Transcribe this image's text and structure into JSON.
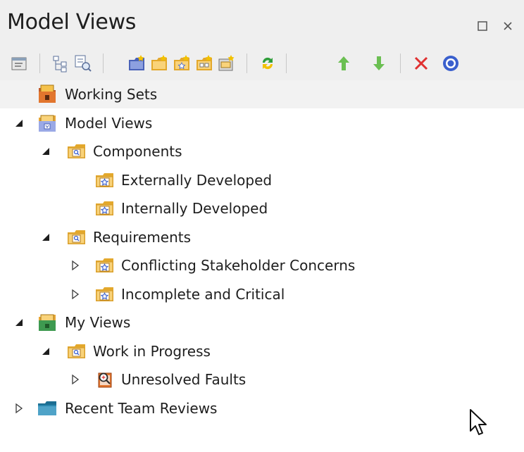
{
  "window": {
    "title": "Model Views",
    "controls": [
      "restore-icon",
      "close-icon"
    ]
  },
  "toolbar": {
    "buttons": [
      {
        "name": "properties-icon"
      },
      {
        "name": "tree-view-icon"
      },
      {
        "name": "find-element-icon"
      },
      {
        "name": "new-view-icon"
      },
      {
        "name": "new-folder-icon"
      },
      {
        "name": "new-search-folder-icon"
      },
      {
        "name": "new-slideshow-icon"
      },
      {
        "name": "new-package-icon"
      },
      {
        "name": "refresh-icon"
      },
      {
        "name": "move-up-icon"
      },
      {
        "name": "move-down-icon"
      },
      {
        "name": "delete-icon"
      },
      {
        "name": "help-icon"
      }
    ]
  },
  "tree": {
    "items": [
      {
        "label": "Working Sets",
        "level": 0,
        "toggle": "none",
        "icon": "working-sets-icon",
        "selected": true
      },
      {
        "label": "Model Views",
        "level": 0,
        "toggle": "expanded",
        "icon": "model-views-root-icon"
      },
      {
        "label": "Components",
        "level": 1,
        "toggle": "expanded",
        "icon": "search-folder-icon"
      },
      {
        "label": "Externally Developed",
        "level": 2,
        "toggle": "none",
        "icon": "favorite-folder-icon"
      },
      {
        "label": "Internally Developed",
        "level": 2,
        "toggle": "none",
        "icon": "favorite-folder-icon"
      },
      {
        "label": "Requirements",
        "level": 1,
        "toggle": "expanded",
        "icon": "search-folder-icon"
      },
      {
        "label": "Conflicting Stakeholder Concerns",
        "level": 2,
        "toggle": "collapsed",
        "icon": "favorite-folder-icon"
      },
      {
        "label": "Incomplete and Critical",
        "level": 2,
        "toggle": "collapsed",
        "icon": "favorite-folder-icon"
      },
      {
        "label": "My Views",
        "level": 0,
        "toggle": "expanded",
        "icon": "my-views-root-icon"
      },
      {
        "label": "Work in Progress",
        "level": 1,
        "toggle": "expanded",
        "icon": "search-folder-icon"
      },
      {
        "label": "Unresolved Faults",
        "level": 2,
        "toggle": "collapsed",
        "icon": "search-results-icon"
      },
      {
        "label": "Recent Team Reviews",
        "level": 0,
        "toggle": "collapsed",
        "icon": "team-reviews-icon"
      }
    ]
  },
  "colors": {
    "panel_header": "#efefef",
    "selection": "#f2f2f2",
    "folder": "#f5c24c",
    "up_arrow": "#6bbf52",
    "delete": "#e03030",
    "help": "#3a5fcd",
    "refresh": "#2f9e3a"
  }
}
